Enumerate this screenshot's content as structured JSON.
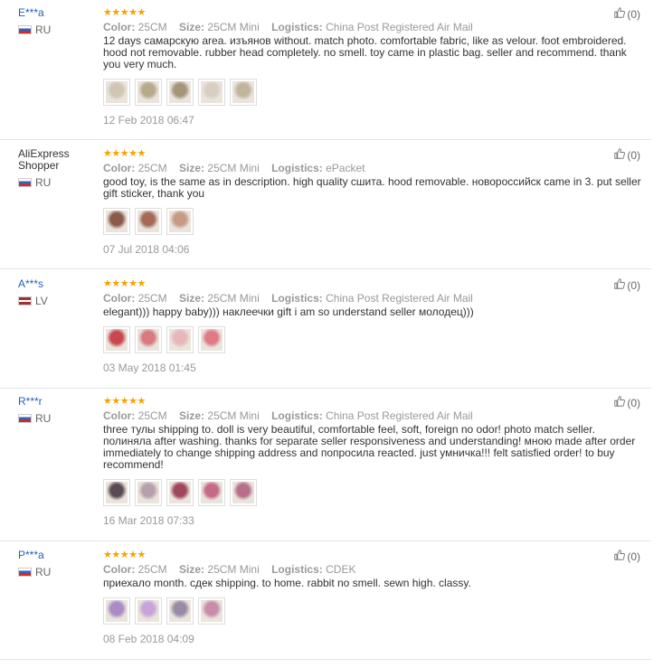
{
  "labels": {
    "color": "Color:",
    "size": "Size:",
    "logistics": "Logistics:"
  },
  "stars": "★★★★★",
  "colors": {
    "username_link": "#2260b8",
    "stars": "#f5a300",
    "meta_text": "#999999",
    "divider": "#e5e5e5"
  },
  "reviews": [
    {
      "user": "E***a",
      "country": "RU",
      "flag": "ru",
      "color": "25CM",
      "size": "25CM Mini",
      "logistics": "China Post Registered Air Mail",
      "text": "12 days самарскую area. изъянов without. match photo. comfortable fabric, like as velour. foot embroidered. hood not removable. rubber head completely. no smell. toy came in plastic bag. seller and recommend. thank you very much.",
      "photo_count": 5,
      "date": "12 Feb 2018 06:47",
      "helpful": "(0)"
    },
    {
      "user": "AliExpress Shopper",
      "country": "RU",
      "flag": "ru",
      "color": "25CM",
      "size": "25CM Mini",
      "logistics": "ePacket",
      "text": "good toy, is the same as in description. high quality сшита. hood removable. новороссийск came in 3. put seller gift sticker, thank you",
      "photo_count": 3,
      "date": "07 Jul 2018 04:06",
      "helpful": "(0)"
    },
    {
      "user": "A***s",
      "country": "LV",
      "flag": "lv",
      "color": "25CM",
      "size": "25CM Mini",
      "logistics": "China Post Registered Air Mail",
      "text": "elegant))) happy baby))) наклеечки gift i am so understand seller молодец)))",
      "photo_count": 4,
      "date": "03 May 2018 01:45",
      "helpful": "(0)"
    },
    {
      "user": "R***r",
      "country": "RU",
      "flag": "ru",
      "color": "25CM",
      "size": "25CM Mini",
      "logistics": "China Post Registered Air Mail",
      "text": "three тулы shipping to. doll is very beautiful, comfortable feel, soft, foreign no odor! photo match seller. полиняла after washing. thanks for separate seller responsiveness and understanding! мною made after order immediately to change shipping address and попросила reacted. just умничка!!! felt satisfied order! to buy recommend!",
      "photo_count": 5,
      "date": "16 Mar 2018 07:33",
      "helpful": "(0)"
    },
    {
      "user": "P***a",
      "country": "RU",
      "flag": "ru",
      "color": "25CM",
      "size": "25CM Mini",
      "logistics": "CDEK",
      "text": "приехало month. сдек shipping. to home. rabbit no smell. sewn high. classy.",
      "photo_count": 4,
      "date": "08 Feb 2018 04:09",
      "helpful": "(0)"
    }
  ]
}
